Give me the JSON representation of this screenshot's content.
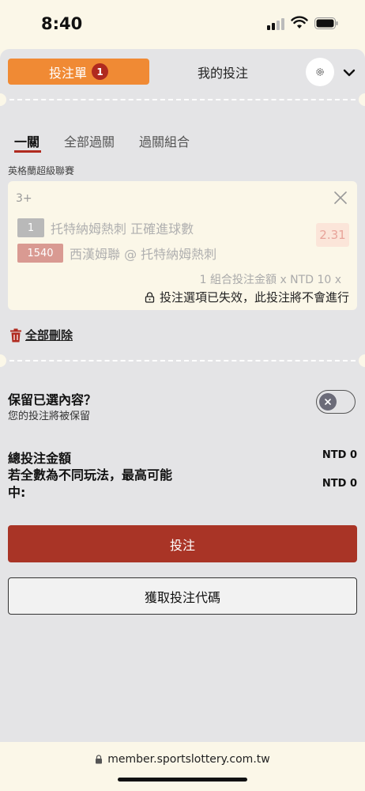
{
  "status_bar": {
    "time": "8:40"
  },
  "header": {
    "betslip_tab": "投注單",
    "betslip_count": "1",
    "mybets_tab": "我的投注"
  },
  "subtabs": [
    "一關",
    "全部過關",
    "過關組合"
  ],
  "league": "英格蘭超級聯賽",
  "bet_card": {
    "type": "3+",
    "legs": [
      {
        "num": "1",
        "text": "托特納姆熱刺 正確進球數",
        "color": "#b9b9b9"
      },
      {
        "num": "1540",
        "text": "西漢姆聯 @ 托特納姆熱刺",
        "color": "#d99a92"
      }
    ],
    "odds": "2.31",
    "summary": "1 組合投注金額 x NTD 10 x",
    "invalid_notice": "投注選項已失效，此投注將不會進行"
  },
  "delete_all": "全部刪除",
  "retain": {
    "title": "保留已選內容？",
    "subtitle": "您的投注將被保留"
  },
  "totals": {
    "total_label": "總投注金額",
    "total_value": "NTD 0",
    "max_label": "若全數為不同玩法，最高可能中:",
    "max_value": "NTD 0"
  },
  "buttons": {
    "bet": "投注",
    "get_code": "獲取投注代碼"
  },
  "browser": {
    "url": "member.sportslottery.com.tw"
  },
  "colors": {
    "accent_orange": "#f08a34",
    "primary_red": "#a93426",
    "badge_red": "#b02a1f"
  }
}
